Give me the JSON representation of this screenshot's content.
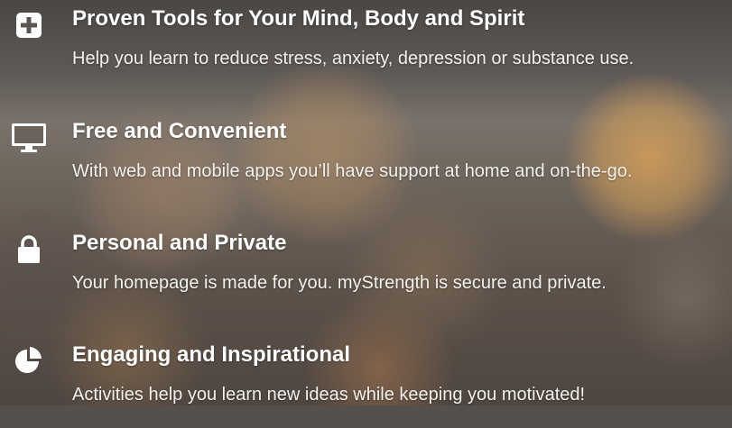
{
  "features": [
    {
      "icon": "plus-square-icon",
      "title": "Proven Tools for Your Mind, Body and Spirit",
      "description": "Help you learn to reduce stress, anxiety, depression or substance use."
    },
    {
      "icon": "desktop-monitor-icon",
      "title": "Free and Convenient",
      "description": "With web and mobile apps you’ll have support at home and on-the-go."
    },
    {
      "icon": "lock-icon",
      "title": "Personal and Private",
      "description": "Your homepage is made for you. myStrength is secure and private."
    },
    {
      "icon": "pie-chart-icon",
      "title": "Engaging and Inspirational",
      "description": "Activities help you learn new ideas while keeping you motivated!"
    }
  ],
  "colors": {
    "text": "#ffffff",
    "icon": "#ffffff"
  }
}
